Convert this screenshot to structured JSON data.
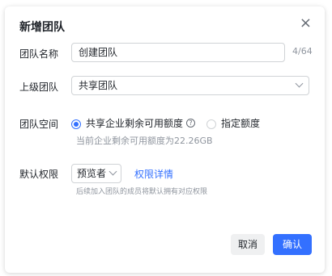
{
  "dialog": {
    "title": "新增团队",
    "close_icon": "close-icon"
  },
  "form": {
    "team_name": {
      "label": "团队名称",
      "value": "创建团队",
      "counter": "4/64"
    },
    "parent_team": {
      "label": "上级团队",
      "value": "共享团队"
    },
    "team_space": {
      "label": "团队空间",
      "options": [
        {
          "label": "共享企业剩余可用额度",
          "selected": true
        },
        {
          "label": "指定额度",
          "selected": false
        }
      ],
      "help_icon": "help-icon",
      "hint": "当前企业剩余可用额度为22.26GB"
    },
    "default_permission": {
      "label": "默认权限",
      "value": "预览者",
      "link": "权限详情",
      "hint": "后续加入团队的成员将默认拥有对应权限"
    }
  },
  "footer": {
    "cancel_label": "取消",
    "confirm_label": "确认"
  },
  "colors": {
    "accent": "#3370ff",
    "text": "#1f2329",
    "muted": "#8f959e",
    "border": "#d0d3d6"
  }
}
